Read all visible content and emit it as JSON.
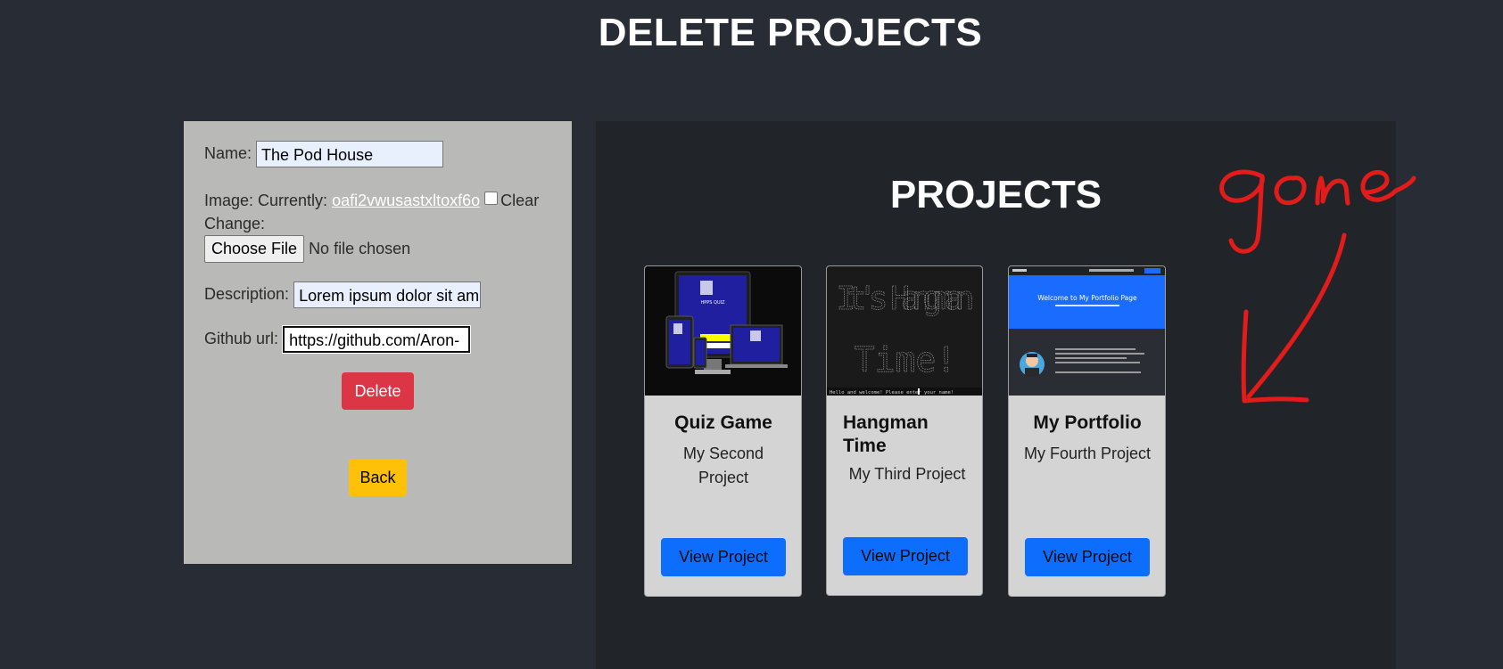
{
  "page_title": "DELETE PROJECTS",
  "form": {
    "name_label": "Name:",
    "name_value": "The Pod House",
    "image_label": "Image: Currently:",
    "image_file": "oafi2vwusastxltoxf6o",
    "clear_label": "Clear",
    "change_label": "Change:",
    "choose_file_label": "Choose File",
    "no_file_text": "No file chosen",
    "description_label": "Description:",
    "description_value": "Lorem ipsum dolor sit am",
    "github_label": "Github url:",
    "github_value": "https://github.com/Aron-",
    "delete_label": "Delete",
    "back_label": "Back"
  },
  "projects": {
    "title": "PROJECTS",
    "cards": [
      {
        "title": "Quiz Game",
        "subtitle": "My Second Project",
        "button": "View Project",
        "image_text": "HPPS QUIZ"
      },
      {
        "title": "Hangman Time",
        "subtitle": "My Third Project",
        "button": "View Project",
        "image_text": "It's Hangman Time!",
        "console_text": "Hello and welcome! Please enter your name!"
      },
      {
        "title": "My Portfolio",
        "subtitle": "My Fourth Project",
        "button": "View Project",
        "image_text": "Welcome to My Portfolio Page"
      }
    ]
  },
  "annotation": {
    "text": "gone",
    "color": "#e21b1b"
  },
  "colors": {
    "background": "#282c34",
    "panel_dark": "#212529",
    "form_bg": "#b9b9b8",
    "delete": "#dc3545",
    "back": "#ffc107",
    "primary": "#0d6efd"
  }
}
